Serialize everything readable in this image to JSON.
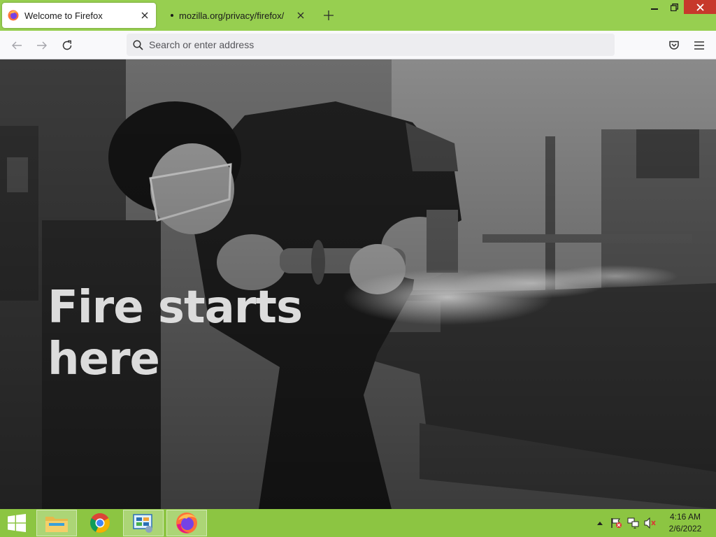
{
  "window": {
    "minimize_icon": "minimize-icon",
    "restore_icon": "restore-icon",
    "close_icon": "close-icon",
    "close_color": "#c7392b"
  },
  "tabs": [
    {
      "title": "Welcome to Firefox",
      "icon": "firefox-icon",
      "active": true
    },
    {
      "title": "mozilla.org/privacy/firefox/",
      "icon": "loading-dot",
      "active": false
    }
  ],
  "tab_bar": {
    "color": "#97cf50",
    "new_tab_icon": "plus-icon"
  },
  "navbar": {
    "back_icon": "arrow-left-icon",
    "forward_icon": "arrow-right-icon",
    "reload_icon": "reload-icon",
    "url_placeholder": "Search or enter address",
    "url_value": "",
    "pocket_icon": "pocket-icon",
    "menu_icon": "hamburger-menu-icon"
  },
  "page": {
    "headline_line1": "Fire starts",
    "headline_line2": "here",
    "image": "black-and-white photo of a welder using an angle grinder with sparks"
  },
  "taskbar": {
    "color": "#8cc542",
    "start_icon": "windows-logo-icon",
    "apps": [
      {
        "name": "File Explorer",
        "icon": "folder-icon"
      },
      {
        "name": "Google Chrome",
        "icon": "chrome-icon"
      },
      {
        "name": "Control Panel",
        "icon": "control-panel-icon"
      },
      {
        "name": "Firefox",
        "icon": "firefox-icon",
        "active": true
      }
    ],
    "tray_icons": [
      "show-hidden-icons-icon",
      "action-center-flag-icon",
      "network-icon",
      "volume-muted-icon"
    ],
    "time": "4:16 AM",
    "date": "2/6/2022"
  }
}
